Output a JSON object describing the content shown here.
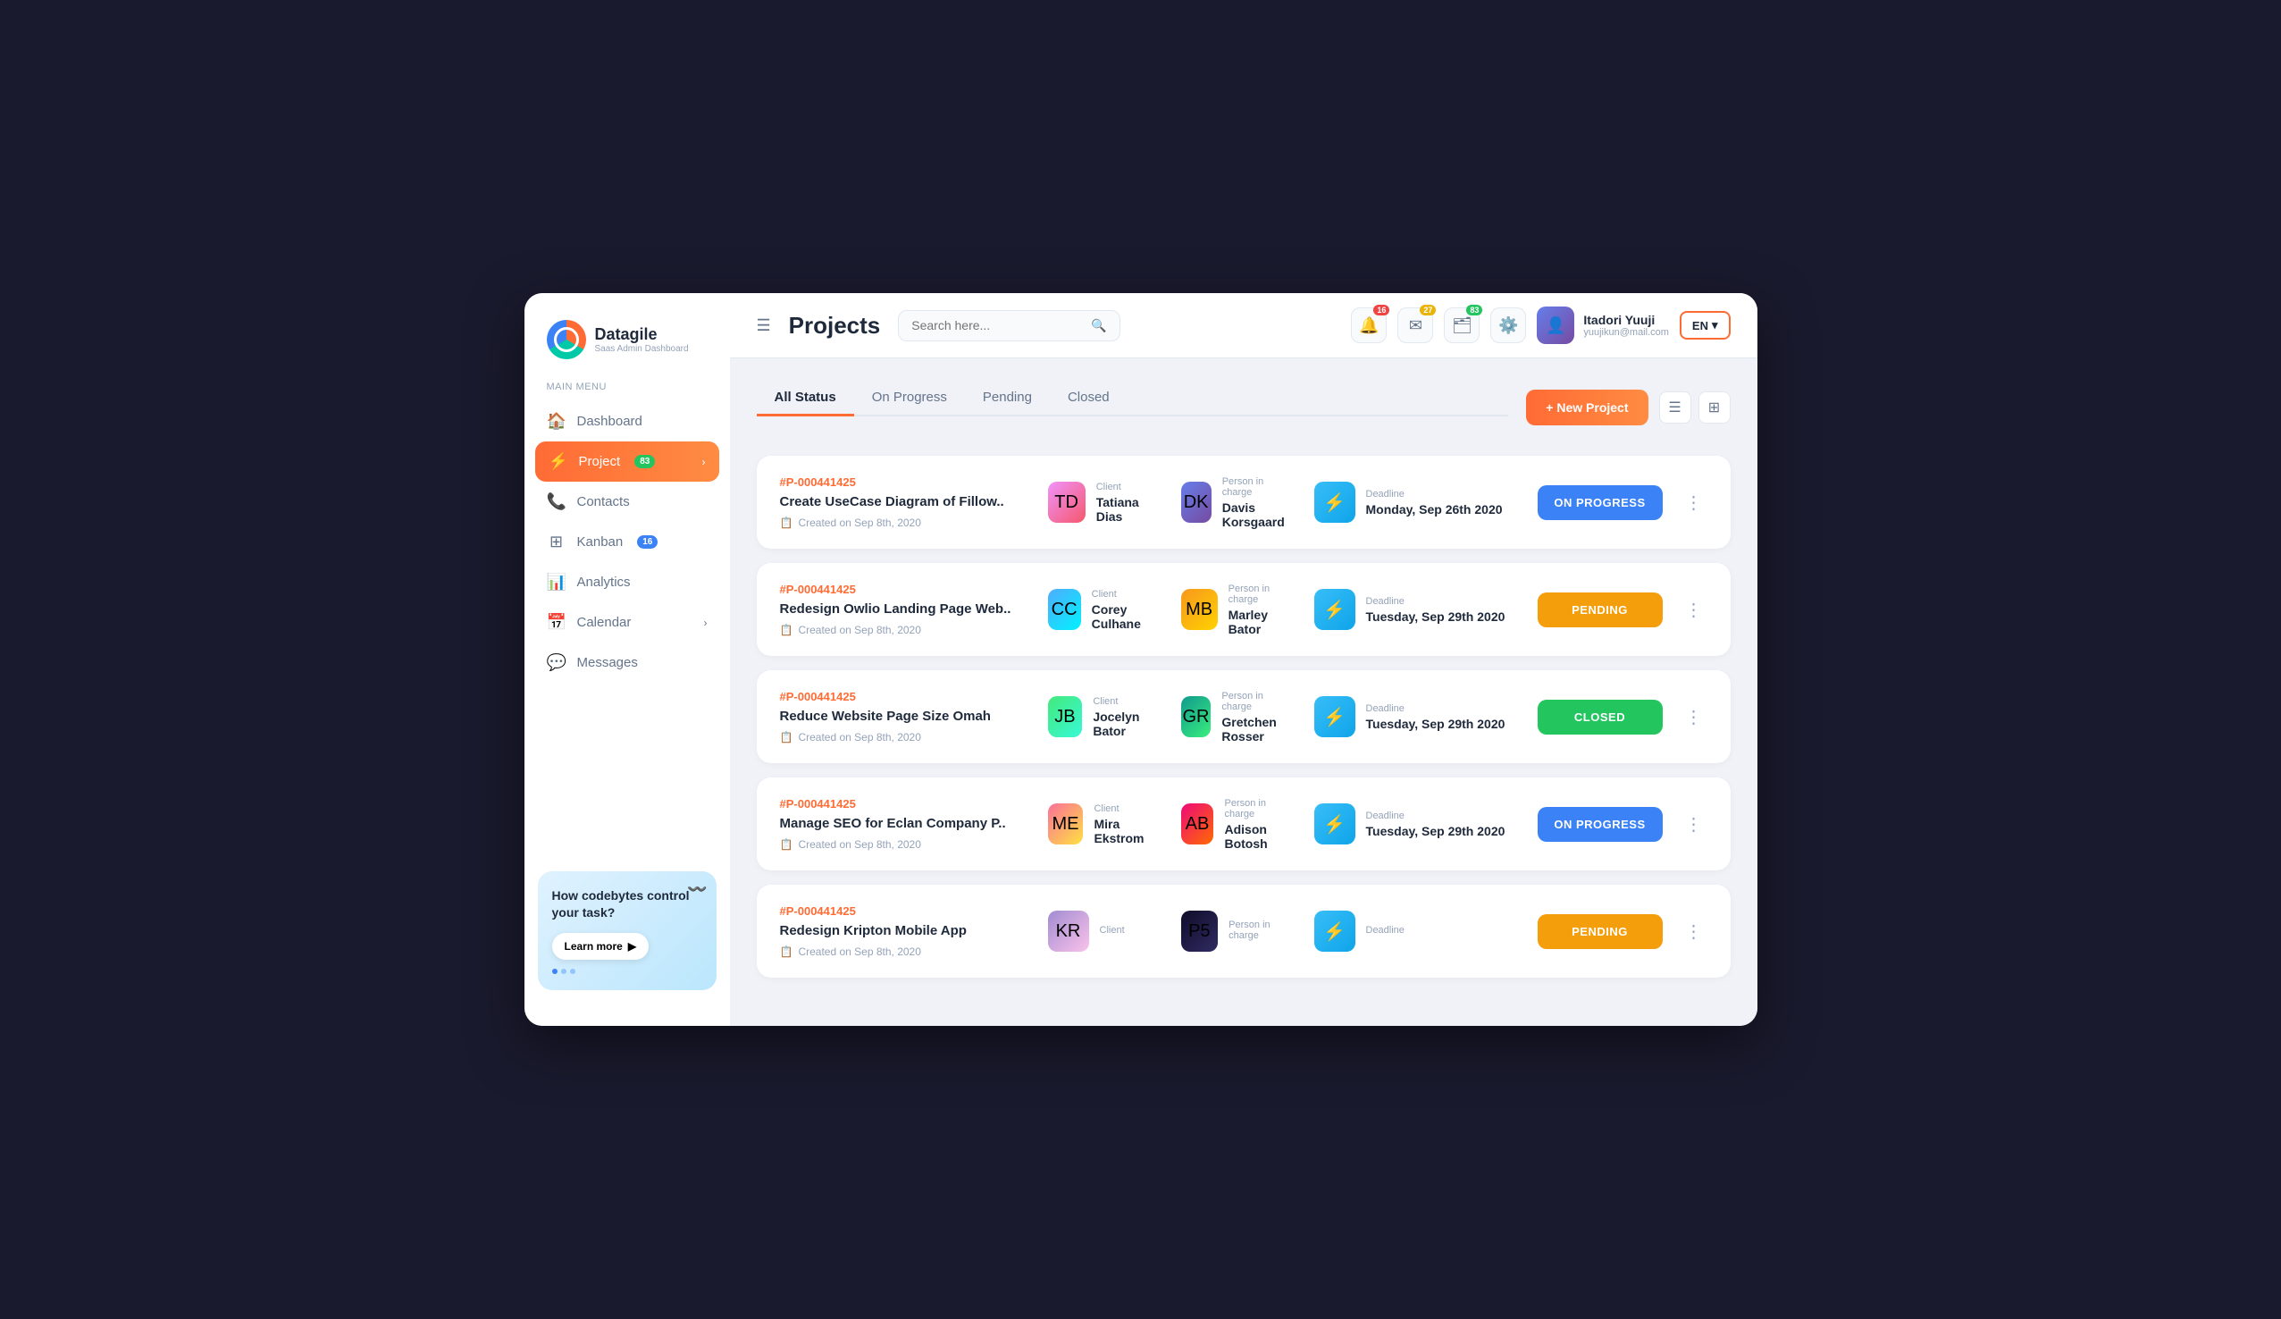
{
  "app": {
    "logo_text": "Datagile",
    "logo_sub": "Saas Admin Dashboard"
  },
  "sidebar": {
    "menu_label": "Main Menu",
    "items": [
      {
        "id": "dashboard",
        "label": "Dashboard",
        "icon": "🏠",
        "active": false,
        "badge": null
      },
      {
        "id": "project",
        "label": "Project",
        "icon": "⚡",
        "active": true,
        "badge": "83"
      },
      {
        "id": "contacts",
        "label": "Contacts",
        "icon": "📞",
        "active": false,
        "badge": null
      },
      {
        "id": "kanban",
        "label": "Kanban",
        "icon": "⊞",
        "active": false,
        "badge": "16"
      },
      {
        "id": "analytics",
        "label": "Analytics",
        "icon": "📊",
        "active": false,
        "badge": null
      },
      {
        "id": "calendar",
        "label": "Calendar",
        "icon": "📅",
        "active": false,
        "badge": null,
        "arrow": "›"
      },
      {
        "id": "messages",
        "label": "Messages",
        "icon": "💬",
        "active": false,
        "badge": null
      }
    ],
    "promo": {
      "title": "How codebytes control your task?",
      "btn_label": "Learn more",
      "btn_arrow": "▶"
    }
  },
  "header": {
    "title": "Projects",
    "search_placeholder": "Search here...",
    "notifications": [
      {
        "icon": "🔔",
        "badge": "16",
        "badge_color": "red"
      },
      {
        "icon": "✉",
        "badge": "27",
        "badge_color": "yellow"
      },
      {
        "icon": "🗂",
        "badge": "83",
        "badge_color": "green"
      }
    ],
    "user": {
      "name": "Itadori Yuuji",
      "email": "yuujikun@mail.com"
    },
    "lang": "EN"
  },
  "tabs": [
    {
      "id": "all",
      "label": "All Status",
      "active": true
    },
    {
      "id": "on-progress",
      "label": "On Progress",
      "active": false
    },
    {
      "id": "pending",
      "label": "Pending",
      "active": false
    },
    {
      "id": "closed",
      "label": "Closed",
      "active": false
    }
  ],
  "new_project_btn": "+ New Project",
  "projects": [
    {
      "id": "#P-000441425",
      "name": "Create UseCase Diagram of Fillow..",
      "created": "Created on Sep 8th, 2020",
      "client_label": "Client",
      "client_name": "Tatiana Dias",
      "client_avatar": "tatiana",
      "person_label": "Person in charge",
      "person_name": "Davis Korsgaard",
      "person_avatar": "davis",
      "deadline_label": "Deadline",
      "deadline_date": "Monday,  Sep 26th 2020",
      "status": "on-progress",
      "status_label": "ON PROGRESS"
    },
    {
      "id": "#P-000441425",
      "name": "Redesign Owlio Landing Page Web..",
      "created": "Created on Sep 8th, 2020",
      "client_label": "Client",
      "client_name": "Corey Culhane",
      "client_avatar": "corey",
      "person_label": "Person in charge",
      "person_name": "Marley Bator",
      "person_avatar": "marley",
      "deadline_label": "Deadline",
      "deadline_date": "Tuesday,  Sep 29th 2020",
      "status": "pending",
      "status_label": "PENDING"
    },
    {
      "id": "#P-000441425",
      "name": "Reduce Website Page Size Omah",
      "created": "Created on Sep 8th, 2020",
      "client_label": "Client",
      "client_name": "Jocelyn Bator",
      "client_avatar": "jocelyn",
      "person_label": "Person in charge",
      "person_name": "Gretchen Rosser",
      "person_avatar": "gretchen",
      "deadline_label": "Deadline",
      "deadline_date": "Tuesday,  Sep 29th 2020",
      "status": "closed",
      "status_label": "CLOSED"
    },
    {
      "id": "#P-000441425",
      "name": "Manage SEO for Eclan Company P..",
      "created": "Created on Sep 8th, 2020",
      "client_label": "Client",
      "client_name": "Mira Ekstrom",
      "client_avatar": "mira",
      "person_label": "Person in charge",
      "person_name": "Adison Botosh",
      "person_avatar": "adison",
      "deadline_label": "Deadline",
      "deadline_date": "Tuesday,  Sep 29th 2020",
      "status": "on-progress",
      "status_label": "ON PROGRESS"
    },
    {
      "id": "#P-000441425",
      "name": "Redesign Kripton Mobile App",
      "created": "Created on Sep 8th, 2020",
      "client_label": "Client",
      "client_name": "",
      "client_avatar": "kripton",
      "person_label": "Person in charge",
      "person_name": "",
      "person_avatar": "person5",
      "deadline_label": "Deadline",
      "deadline_date": "",
      "status": "pending",
      "status_label": "PENDING"
    }
  ]
}
